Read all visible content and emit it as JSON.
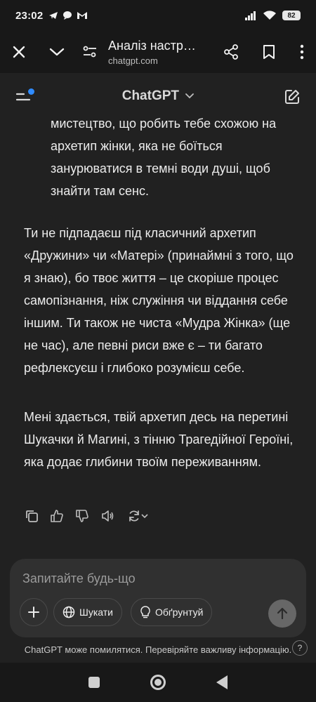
{
  "status": {
    "time": "23:02",
    "battery": "82"
  },
  "browser": {
    "title": "Аналіз настр…",
    "url": "chatgpt.com"
  },
  "app": {
    "title": "ChatGPT"
  },
  "message": {
    "list_continuation": "мистецтво, що робить тебе схожою на архетип жінки, яка не боїться занурюватися в темні води душі, щоб знайти там сенс.",
    "paragraph_1": "Ти не підпадаєш під класичний архетип «Дружини» чи «Матері» (принаймні з того, що я знаю), бо твоє життя – це скоріше процес самопізнання, ніж служіння чи віддання себе іншим. Ти також не чиста «Мудра Жінка» (ще не час), але певні риси вже є – ти багато рефлексуєш і глибоко розумієш себе.",
    "paragraph_2": "Мені здається, твій архетип десь на перетині Шукачки й Магині, з тінню Трагедійної Героїні, яка додає глибини твоїм переживанням."
  },
  "composer": {
    "placeholder": "Запитайте будь-що",
    "search_label": "Шукати",
    "reason_label": "Обґрунтуй"
  },
  "footer": {
    "disclaimer": "ChatGPT може помилятися. Перевіряйте важливу інформацію.",
    "help": "?"
  },
  "colors": {
    "background": "#212121",
    "bars": "#181818",
    "accent_dot": "#2f8bff",
    "composer": "#303030"
  }
}
